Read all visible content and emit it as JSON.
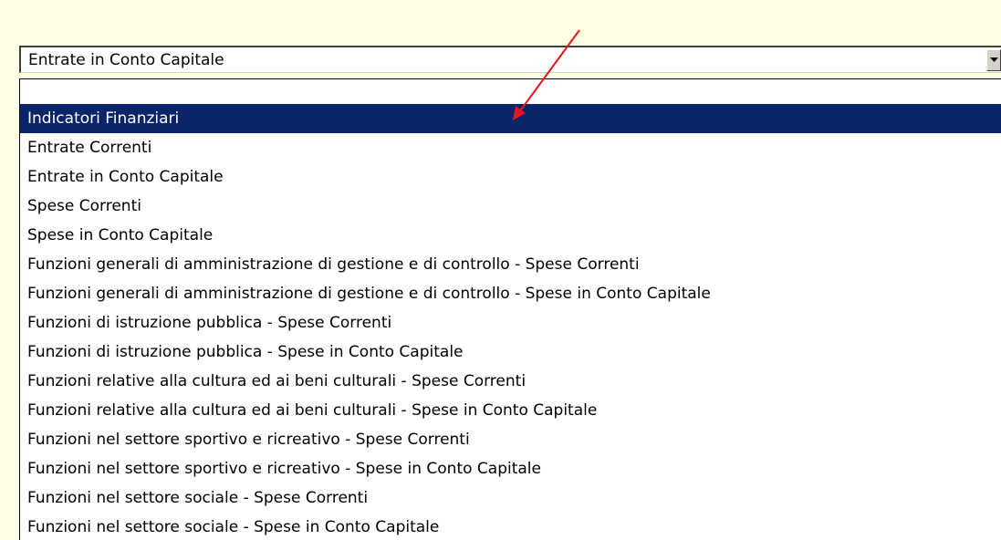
{
  "dropdown": {
    "selected_value": "Entrate in Conto Capitale",
    "button_icon": "chevron-down-icon"
  },
  "list": {
    "selected_index": 0,
    "items": [
      "Indicatori Finanziari",
      "Entrate Correnti",
      "Entrate in Conto Capitale",
      "Spese Correnti",
      "Spese in Conto Capitale",
      "Funzioni generali di amministrazione di gestione e di controllo - Spese Correnti",
      "Funzioni generali di amministrazione di gestione e di controllo - Spese in Conto Capitale",
      "Funzioni di istruzione pubblica - Spese Correnti",
      "Funzioni di istruzione pubblica - Spese in Conto Capitale",
      "Funzioni relative alla cultura ed ai beni culturali - Spese Correnti",
      "Funzioni relative alla cultura ed ai beni culturali - Spese in Conto Capitale",
      "Funzioni nel settore sportivo e ricreativo - Spese Correnti",
      "Funzioni nel settore sportivo e ricreativo - Spese in Conto Capitale",
      "Funzioni nel settore sociale - Spese Correnti",
      "Funzioni nel settore sociale - Spese in Conto Capitale"
    ]
  },
  "colors": {
    "background": "#fffde4",
    "selection": "#0a246a",
    "annotation_arrow": "#e8141c"
  },
  "annotation": {
    "icon": "red-arrow-icon"
  }
}
